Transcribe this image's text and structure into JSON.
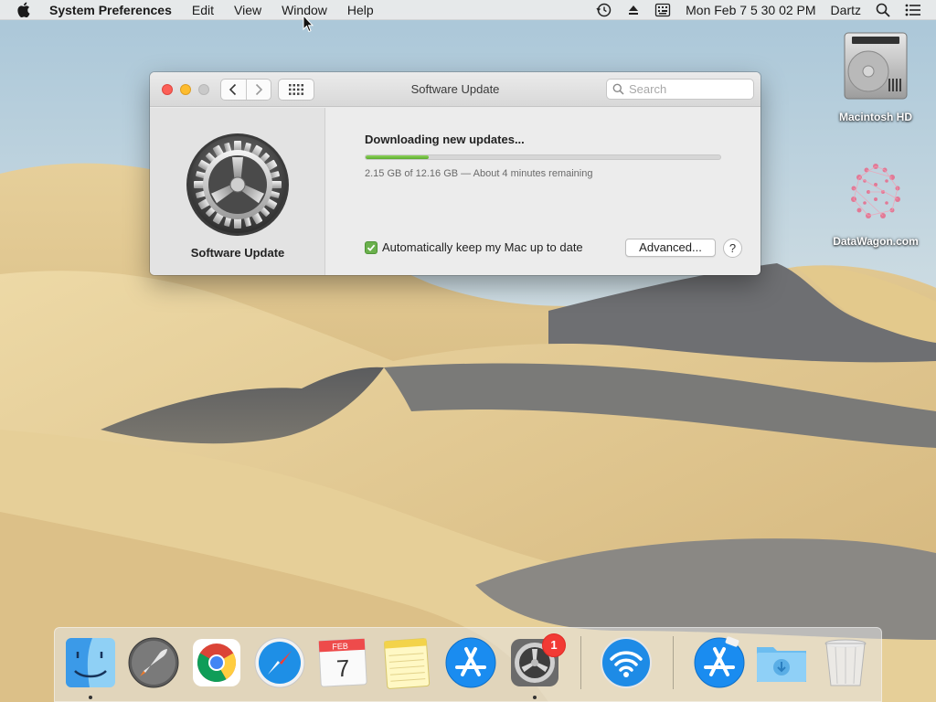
{
  "menubar": {
    "apple_icon": "apple-logo-icon",
    "app_name": "System Preferences",
    "items": [
      "Edit",
      "View",
      "Window",
      "Help"
    ],
    "status_icons": [
      "time-machine-icon",
      "eject-icon",
      "keyboard-input-icon"
    ],
    "clock": "Mon Feb 7  5 30 02 PM",
    "user": "Dartz",
    "right_icons": [
      "spotlight-search-icon",
      "notification-center-icon"
    ]
  },
  "desktop": {
    "icons": [
      {
        "label": "Macintosh HD",
        "icon": "hard-drive-icon"
      },
      {
        "label": "DataWagon.com",
        "icon": "datawagon-logo-icon"
      }
    ]
  },
  "window": {
    "title": "Software Update",
    "search_placeholder": "Search",
    "sidebar_label": "Software Update",
    "status": "Downloading new updates...",
    "progress": {
      "downloaded": "2.15 GB",
      "total": "12.16 GB",
      "fraction": 0.177,
      "text": "2.15 GB of 12.16 GB — About 4 minutes remaining"
    },
    "auto_update": {
      "checked": true,
      "label": "Automatically keep my Mac up to date"
    },
    "advanced_label": "Advanced...",
    "help_label": "?"
  },
  "dock": {
    "items": [
      "Finder",
      "Launchpad",
      "Google Chrome",
      "Safari",
      "Calendar",
      "Notes",
      "App Store",
      "System Preferences",
      "Wireless Diagnostics",
      "App Store",
      "Downloads",
      "Trash"
    ],
    "calendar": {
      "month": "FEB",
      "day": "7"
    },
    "sys_prefs_badge": "1"
  },
  "colors": {
    "accent_green": "#5aaa2e",
    "close": "#fc5f57",
    "minimize": "#fdbc2e",
    "badge": "#f23a34"
  }
}
